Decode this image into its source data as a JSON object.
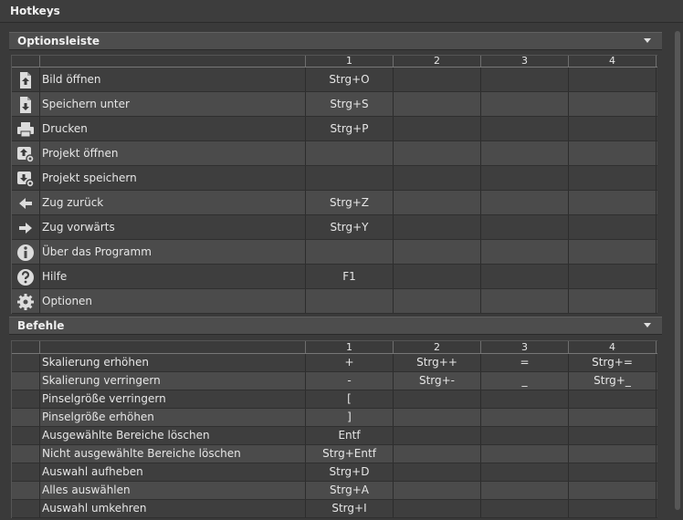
{
  "window": {
    "title": "Hotkeys"
  },
  "sections": [
    {
      "title": "Optionsleiste",
      "columns": [
        "1",
        "2",
        "3",
        "4"
      ],
      "rows": [
        {
          "icon": "open-image-icon",
          "label": "Bild öffnen",
          "keys": [
            "Strg+O",
            "",
            "",
            ""
          ]
        },
        {
          "icon": "save-as-icon",
          "label": "Speichern unter",
          "keys": [
            "Strg+S",
            "",
            "",
            ""
          ]
        },
        {
          "icon": "printer-icon",
          "label": "Drucken",
          "keys": [
            "Strg+P",
            "",
            "",
            ""
          ]
        },
        {
          "icon": "open-project-icon",
          "label": "Projekt öffnen",
          "keys": [
            "",
            "",
            "",
            ""
          ]
        },
        {
          "icon": "save-project-icon",
          "label": "Projekt speichern",
          "keys": [
            "",
            "",
            "",
            ""
          ]
        },
        {
          "icon": "arrow-left-icon",
          "label": "Zug zurück",
          "keys": [
            "Strg+Z",
            "",
            "",
            ""
          ]
        },
        {
          "icon": "arrow-right-icon",
          "label": "Zug vorwärts",
          "keys": [
            "Strg+Y",
            "",
            "",
            ""
          ]
        },
        {
          "icon": "info-icon",
          "label": "Über das Programm",
          "keys": [
            "",
            "",
            "",
            ""
          ]
        },
        {
          "icon": "help-icon",
          "label": "Hilfe",
          "keys": [
            "F1",
            "",
            "",
            ""
          ]
        },
        {
          "icon": "gear-icon",
          "label": "Optionen",
          "keys": [
            "",
            "",
            "",
            ""
          ]
        }
      ]
    },
    {
      "title": "Befehle",
      "columns": [
        "1",
        "2",
        "3",
        "4"
      ],
      "rows": [
        {
          "label": "Skalierung erhöhen",
          "keys": [
            "+",
            "Strg++",
            "=",
            "Strg+="
          ]
        },
        {
          "label": "Skalierung verringern",
          "keys": [
            "-",
            "Strg+-",
            "_",
            "Strg+_"
          ]
        },
        {
          "label": "Pinselgröße verringern",
          "keys": [
            "[",
            "",
            "",
            ""
          ]
        },
        {
          "label": "Pinselgröße erhöhen",
          "keys": [
            "]",
            "",
            "",
            ""
          ]
        },
        {
          "label": "Ausgewählte Bereiche löschen",
          "keys": [
            "Entf",
            "",
            "",
            ""
          ]
        },
        {
          "label": "Nicht ausgewählte Bereiche löschen",
          "keys": [
            "Strg+Entf",
            "",
            "",
            ""
          ]
        },
        {
          "label": "Auswahl aufheben",
          "keys": [
            "Strg+D",
            "",
            "",
            ""
          ]
        },
        {
          "label": "Alles auswählen",
          "keys": [
            "Strg+A",
            "",
            "",
            ""
          ]
        },
        {
          "label": "Auswahl umkehren",
          "keys": [
            "Strg+I",
            "",
            "",
            ""
          ]
        }
      ]
    }
  ]
}
